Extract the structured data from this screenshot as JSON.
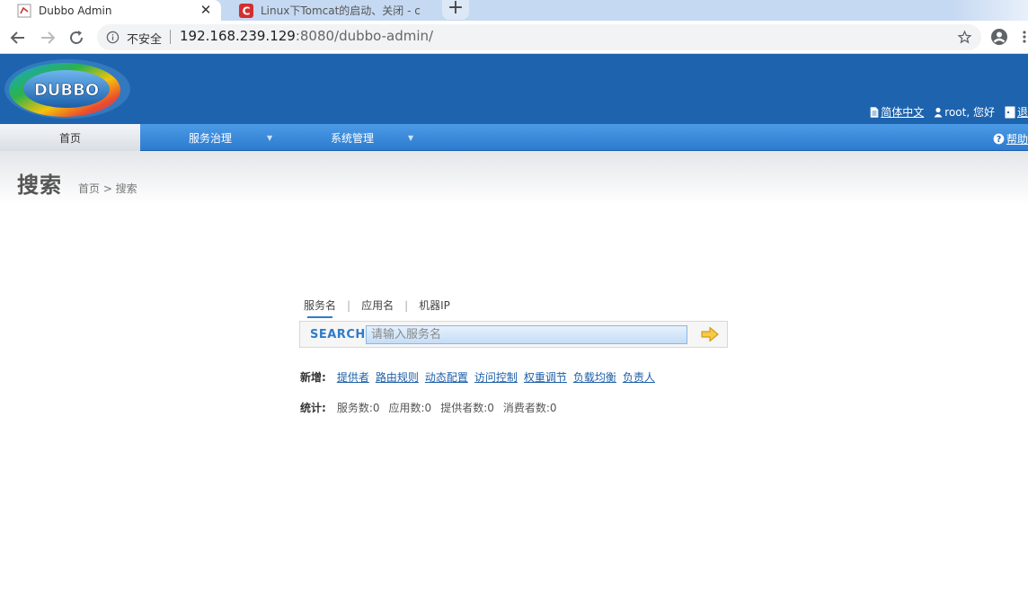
{
  "browser": {
    "tabs": [
      {
        "title": "Dubbo Admin",
        "active": true
      },
      {
        "title": "Linux下Tomcat的启动、关闭 - c",
        "active": false
      }
    ],
    "tab_close_glyph": "✕",
    "new_tab_glyph": "+",
    "security_label": "不安全",
    "url_host": "192.168.239.129",
    "url_rest": ":8080/dubbo-admin/"
  },
  "header": {
    "logo_text": "DUBBO",
    "language_link": "简体中文",
    "user_greeting": "root, 您好",
    "logout_label": "退"
  },
  "nav": {
    "home": "首页",
    "service_governance": "服务治理",
    "system_management": "系统管理",
    "dropdown_glyph": "▼",
    "help": "帮助"
  },
  "page": {
    "title": "搜索",
    "breadcrumb": "首页 > 搜索"
  },
  "search": {
    "tabs": [
      "服务名",
      "应用名",
      "机器IP"
    ],
    "tab_separator": "|",
    "label": "SEARCH",
    "placeholder": "请输入服务名",
    "value": ""
  },
  "add": {
    "label": "新增:",
    "links": [
      "提供者",
      "路由规则",
      "动态配置",
      "访问控制",
      "权重调节",
      "负载均衡",
      "负责人"
    ]
  },
  "stats": {
    "label": "统计:",
    "items": [
      "服务数:0",
      "应用数:0",
      "提供者数:0",
      "消费者数:0"
    ]
  },
  "colors": {
    "header_blue": "#1e63ae",
    "nav_blue": "#2c7bd0",
    "link_blue": "#1e5fa8",
    "search_label_blue": "#2f7cc9"
  }
}
